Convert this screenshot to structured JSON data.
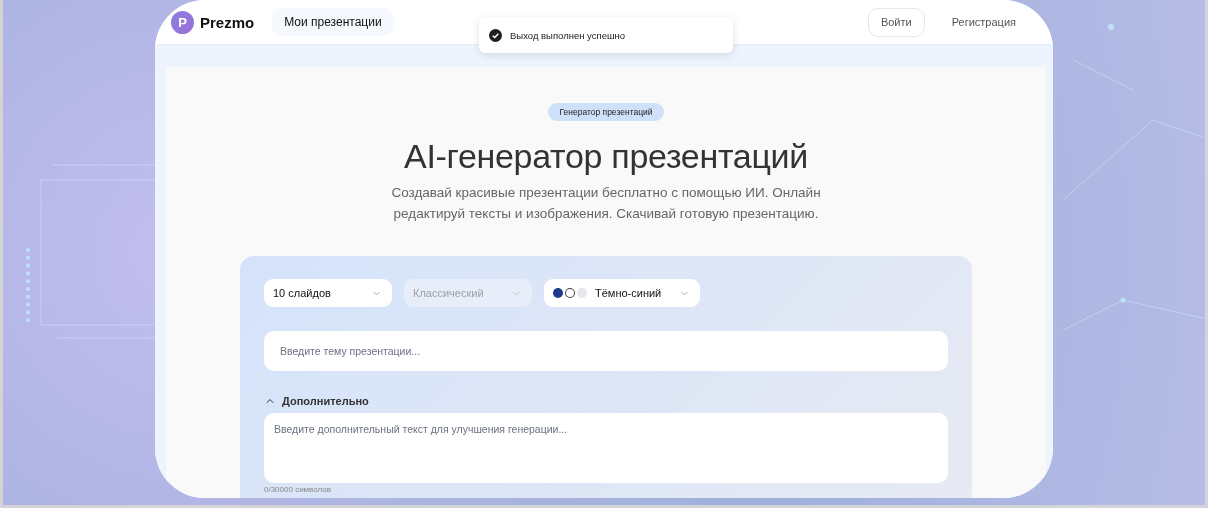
{
  "header": {
    "logo": {
      "letter": "P",
      "name": "Prezmo"
    },
    "nav": [
      {
        "label": "Мои презентации"
      }
    ],
    "actions": [
      {
        "kind": "outlined",
        "label": "Войти"
      },
      {
        "kind": "text",
        "label": "Регистрация"
      }
    ]
  },
  "toast": {
    "message": "Выход выполнен успешно"
  },
  "hero": {
    "badge": "Генератор презентаций",
    "title": "AI-генератор презентаций",
    "subtitle": "Создавай красивые презентации бесплатно с помощью ИИ. Онлайн редактируй тексты и изображения. Скачивай готовую презентацию."
  },
  "form": {
    "selects": [
      {
        "value": "10 слайдов",
        "disabled": false
      },
      {
        "value": "Классический",
        "disabled": true
      },
      {
        "value": "Тёмно-синий",
        "disabled": false,
        "swatches": [
          {
            "color": "#1e3a8a"
          },
          {
            "color": "#ffffff"
          },
          {
            "color": "#e5e7eb"
          }
        ]
      }
    ],
    "topic": {
      "placeholder": "Введите тему презентации..."
    },
    "extra": {
      "label": "Дополнительно",
      "expanded": true,
      "placeholder": "Введите дополнительный текст для улучшения генерации...",
      "counter": "0/30000 символов"
    }
  }
}
